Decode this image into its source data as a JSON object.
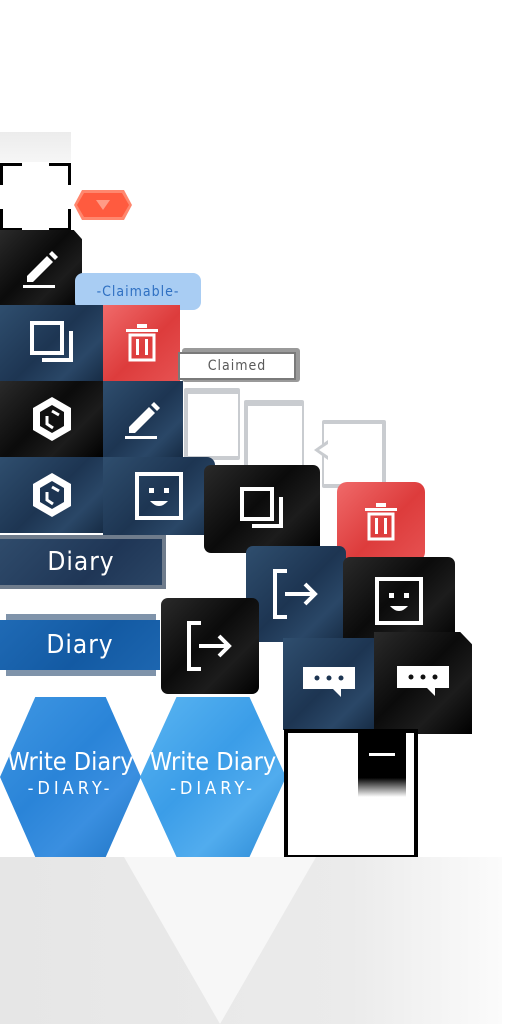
{
  "labels": {
    "claimable": "-Claimable-",
    "claimed": "Claimed",
    "diary_dark": "Diary",
    "diary_blue": "Diary",
    "write_diary_1": "Write Diary",
    "write_diary_1_sub": "-DIARY-",
    "write_diary_2": "Write Diary",
    "write_diary_2_sub": "-DIARY-"
  },
  "icons": {
    "edit": "pencil-icon",
    "copy": "copy-icon",
    "delete": "trash-icon",
    "hexagon": "hexagon-logo-icon",
    "face": "smiley-face-icon",
    "exit": "exit-icon",
    "chat": "chat-bubble-icon",
    "minus": "minus-icon",
    "arrow_down": "triangle-down-icon"
  },
  "colors": {
    "navy": "#1d3552",
    "dark": "#0b0b0b",
    "red": "#dd3c3c",
    "accent_blue": "#2c7fd6",
    "claimable_bg": "#a9cdf3",
    "claimable_text": "#2f70c2",
    "orange": "#ff6a4f"
  }
}
